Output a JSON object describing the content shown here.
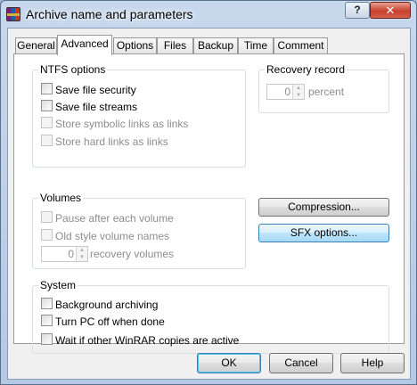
{
  "window": {
    "title": "Archive name and parameters",
    "help_label": "?",
    "close_label": "✕"
  },
  "tabs": [
    {
      "label": "General"
    },
    {
      "label": "Advanced"
    },
    {
      "label": "Options"
    },
    {
      "label": "Files"
    },
    {
      "label": "Backup"
    },
    {
      "label": "Time"
    },
    {
      "label": "Comment"
    }
  ],
  "active_tab": "Advanced",
  "ntfs": {
    "title": "NTFS options",
    "items": [
      {
        "label": "Save file security",
        "checked": false,
        "enabled": true
      },
      {
        "label": "Save file streams",
        "checked": false,
        "enabled": true
      },
      {
        "label": "Store symbolic links as links",
        "checked": false,
        "enabled": false
      },
      {
        "label": "Store hard links as links",
        "checked": false,
        "enabled": false
      }
    ]
  },
  "recovery": {
    "title": "Recovery record",
    "value": "0",
    "unit": "percent"
  },
  "volumes": {
    "title": "Volumes",
    "items": [
      {
        "label": "Pause after each volume",
        "checked": false,
        "enabled": false
      },
      {
        "label": "Old style volume names",
        "checked": false,
        "enabled": false
      }
    ],
    "recovery_value": "0",
    "recovery_label": "recovery volumes"
  },
  "buttons": {
    "compression": "Compression...",
    "sfx": "SFX options..."
  },
  "system": {
    "title": "System",
    "items": [
      {
        "label": "Background archiving",
        "checked": false,
        "enabled": true
      },
      {
        "label": "Turn PC off when done",
        "checked": false,
        "enabled": true
      },
      {
        "label": "Wait if other WinRAR copies are active",
        "checked": false,
        "enabled": true
      }
    ]
  },
  "footer": {
    "ok": "OK",
    "cancel": "Cancel",
    "help": "Help"
  }
}
